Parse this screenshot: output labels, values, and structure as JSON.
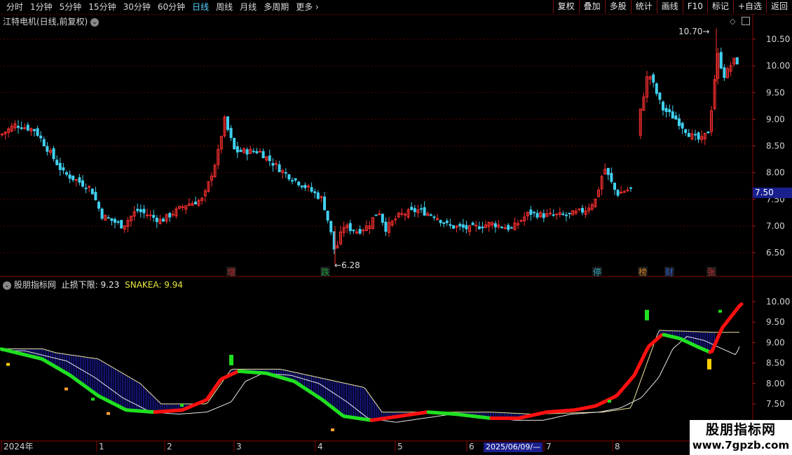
{
  "toolbar": {
    "periods": [
      "分时",
      "1分钟",
      "5分钟",
      "15分钟",
      "30分钟",
      "60分钟",
      "日线",
      "周线",
      "月线",
      "多周期",
      "更多"
    ],
    "active_period": "日线",
    "buttons": [
      "复权",
      "叠加",
      "多股",
      "统计",
      "画线",
      "F10",
      "标记",
      "+自选",
      "返回"
    ]
  },
  "main_panel": {
    "title": "江特电机(日线,前复权)",
    "y_ticks": [
      "10.50",
      "10.00",
      "9.50",
      "9.00",
      "8.50",
      "8.00",
      "7.50",
      "7.00",
      "6.50"
    ],
    "current_price": "7.50",
    "high_annotation": "10.70",
    "low_annotation": "6.28",
    "event_markers": [
      {
        "label": "增",
        "color": "#c83030"
      },
      {
        "label": "跌",
        "color": "#20a040"
      },
      {
        "label": "停",
        "color": "#2aa8c0"
      },
      {
        "label": "榜",
        "color": "#d08020"
      },
      {
        "label": "财",
        "color": "#3060d0"
      },
      {
        "label": "张",
        "color": "#c83030"
      }
    ]
  },
  "indicator_panel": {
    "name": "股朋指标网",
    "stop_label": "止损下限:",
    "stop_value": "9.23",
    "snake_label": "SNAKEA:",
    "snake_value": "9.94",
    "y_ticks": [
      "10.00",
      "9.50",
      "9.00",
      "8.50",
      "8.00",
      "7.50"
    ]
  },
  "x_axis": {
    "labels": [
      "2024年",
      "1",
      "2",
      "3",
      "4",
      "5",
      "6",
      "7",
      "8"
    ],
    "cursor_date": "2025/06/09/—"
  },
  "watermark": {
    "title": "股朋指标网",
    "url": "www.7gpzb.com"
  },
  "colors": {
    "up": "#ff3030",
    "down": "#40d0f0",
    "snake_up": "#ff1010",
    "snake_down": "#20e020",
    "hatch": "#2020c0"
  }
}
